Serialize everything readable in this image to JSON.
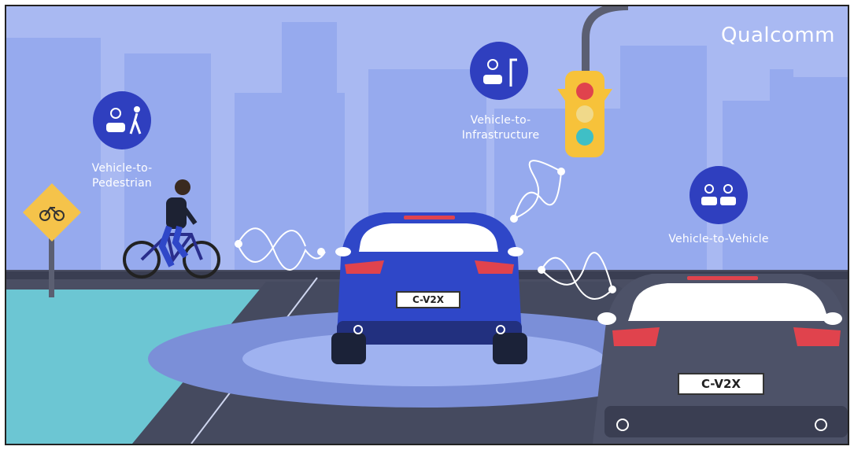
{
  "brand": {
    "name": "Qualcomm"
  },
  "labels": {
    "v2p": "Vehicle-to-\nPedestrian",
    "v2i": "Vehicle-to-\nInfrastructure",
    "v2v": "Vehicle-to-Vehicle"
  },
  "plates": {
    "front_car": "C-V2X",
    "rear_car": "C-V2X"
  },
  "icons": {
    "v2p": "car-and-pedestrian-icon",
    "v2i": "car-and-streetlight-icon",
    "v2v": "two-cars-icon",
    "sign": "bicycle-warning-sign-icon",
    "traffic_light": "traffic-light-icon"
  },
  "colors": {
    "sky": "#a9b9f2",
    "buildings": "#92a7ea",
    "road": "#4a4e63",
    "water": "#6cc6d3",
    "icon_circle": "#2f3fbf",
    "car_blue": "#2f47c8",
    "car_gray": "#4d5268",
    "traffic_light": "#f7c23a"
  }
}
